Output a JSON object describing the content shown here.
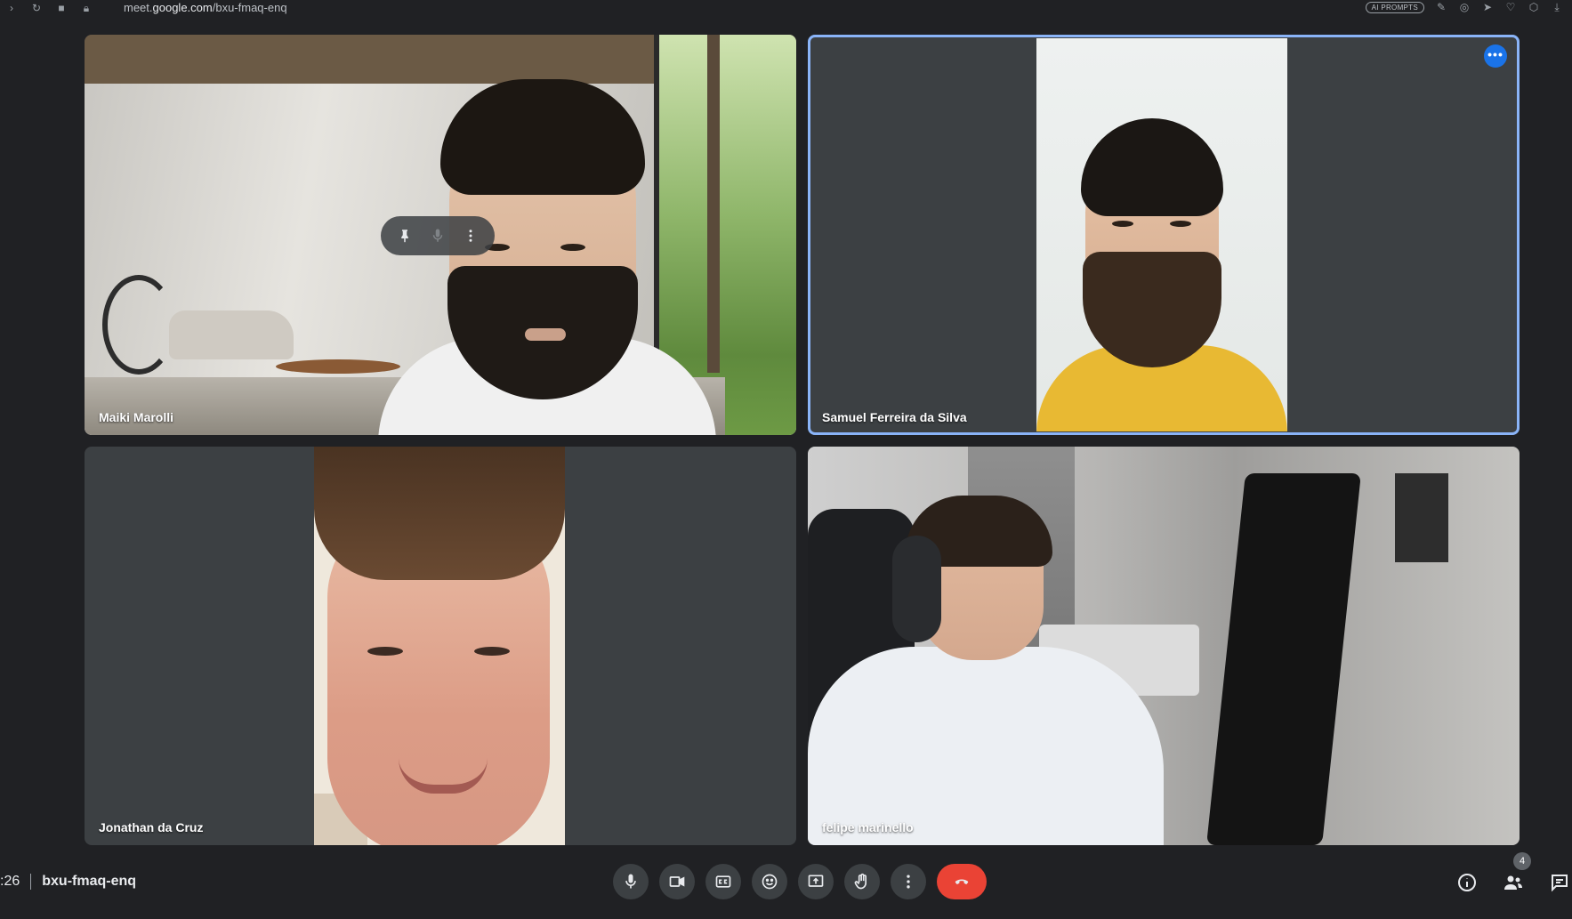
{
  "browser": {
    "url_prefix": "meet.",
    "url_domain": "google.com",
    "url_path": "/bxu-fmaq-enq",
    "extension_pill": "AI PROMPTS"
  },
  "tiles": [
    {
      "name": "Maiki Marolli"
    },
    {
      "name": "Samuel Ferreira da Silva"
    },
    {
      "name": "Jonathan da Cruz"
    },
    {
      "name": "felipe marinello"
    }
  ],
  "bottombar": {
    "time": ":26",
    "meeting_code": "bxu-fmaq-enq",
    "participants_count": "4"
  },
  "colors": {
    "background": "#202124",
    "tile": "#3c4043",
    "active_border": "#8ab4f8",
    "end_call": "#ea4335",
    "accent": "#1a73e8"
  }
}
